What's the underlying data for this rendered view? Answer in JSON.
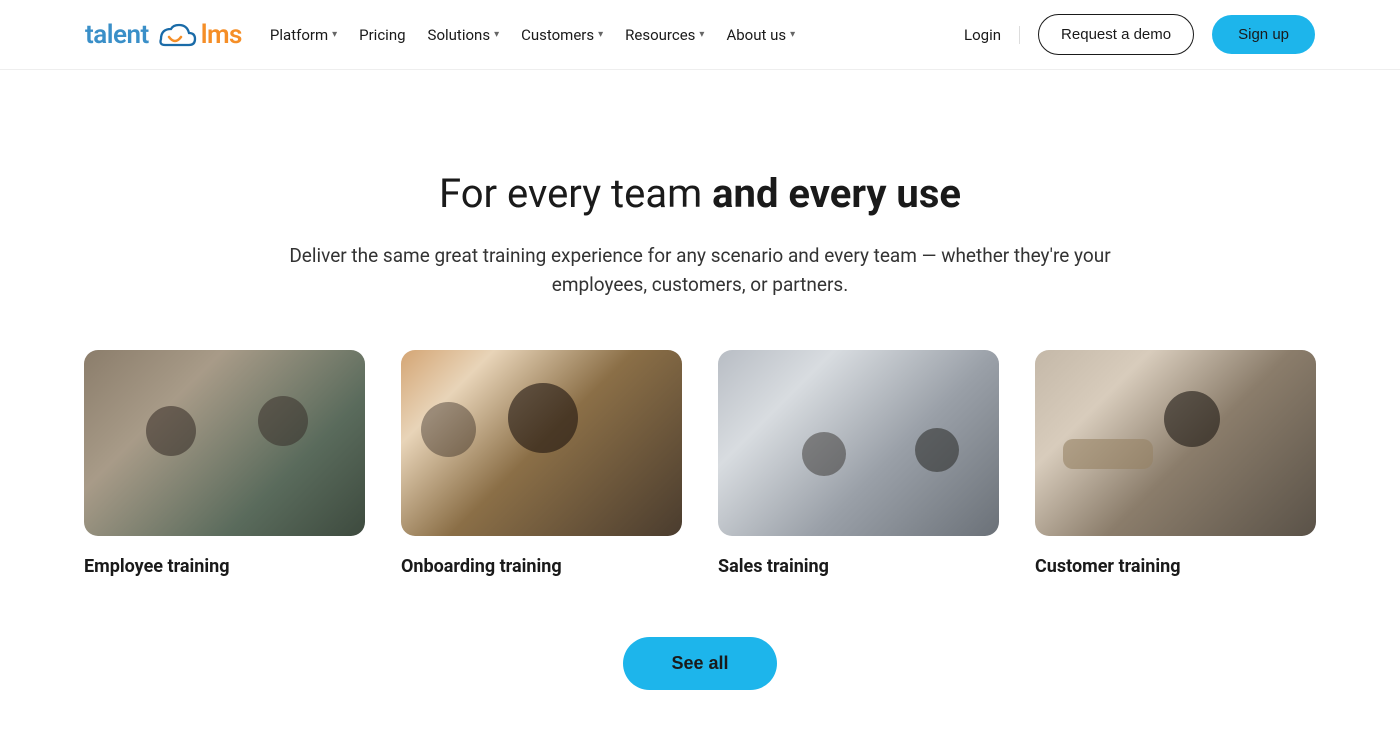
{
  "logo": {
    "part1": "talent",
    "part2": "lms"
  },
  "nav": {
    "items": [
      {
        "label": "Platform",
        "dropdown": true
      },
      {
        "label": "Pricing",
        "dropdown": false
      },
      {
        "label": "Solutions",
        "dropdown": true
      },
      {
        "label": "Customers",
        "dropdown": true
      },
      {
        "label": "Resources",
        "dropdown": true
      },
      {
        "label": "About us",
        "dropdown": true
      }
    ]
  },
  "header_actions": {
    "login": "Login",
    "request_demo": "Request a demo",
    "sign_up": "Sign up"
  },
  "hero": {
    "headline_light": "For every team ",
    "headline_bold": "and every use",
    "subtext": "Deliver the same great training experience for any scenario and every team — whether they're your employees, customers, or partners."
  },
  "cards": [
    {
      "title": "Employee training"
    },
    {
      "title": "Onboarding training"
    },
    {
      "title": "Sales training"
    },
    {
      "title": "Customer training"
    }
  ],
  "see_all": "See all"
}
